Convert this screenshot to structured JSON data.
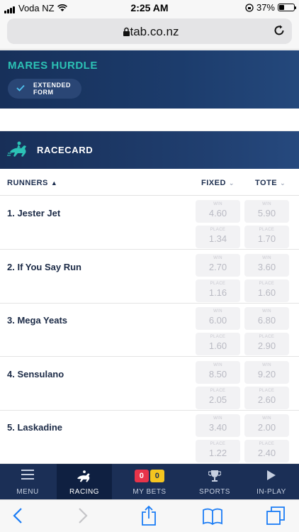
{
  "status": {
    "carrier": "Voda NZ",
    "time": "2:25 AM",
    "battery": "37%",
    "battery_fraction": 0.37
  },
  "browser": {
    "url": "tab.co.nz"
  },
  "race": {
    "title": "MARES HURDLE",
    "extended_form_line1": "EXTENDED",
    "extended_form_line2": "FORM"
  },
  "racecard": {
    "title": "RACECARD"
  },
  "columns": {
    "runners": "RUNNERS",
    "fixed": "FIXED",
    "tote": "TOTE"
  },
  "runners": [
    {
      "name": "1.  Jester Jet",
      "fixed_win": "4.60",
      "tote_win": "5.90",
      "fixed_place": "1.34",
      "tote_place": "1.70"
    },
    {
      "name": "2.  If You Say Run",
      "fixed_win": "2.70",
      "tote_win": "3.60",
      "fixed_place": "1.16",
      "tote_place": "1.60"
    },
    {
      "name": "3.  Mega Yeats",
      "fixed_win": "6.00",
      "tote_win": "6.80",
      "fixed_place": "1.60",
      "tote_place": "2.90"
    },
    {
      "name": "4.  Sensulano",
      "fixed_win": "8.50",
      "tote_win": "9.20",
      "fixed_place": "2.05",
      "tote_place": "2.60"
    },
    {
      "name": "5.  Laskadine",
      "fixed_win": "3.40",
      "tote_win": "2.00",
      "fixed_place": "1.22",
      "tote_place": "2.40"
    }
  ],
  "odds_labels": {
    "win": "WIN",
    "place": "PLACE"
  },
  "nav": {
    "menu": "MENU",
    "racing": "RACING",
    "mybets": "MY BETS",
    "sports": "SPORTS",
    "inplay": "IN-PLAY",
    "badge_red": "0",
    "badge_yellow": "0"
  },
  "colors": {
    "accent_teal": "#2cc2b5",
    "nav_bg": "#1b2f56",
    "safari_blue": "#1a7cf5"
  },
  "icons": [
    "wifi-icon",
    "lock-icon",
    "reload-icon",
    "check-icon",
    "jockey-icon",
    "chevron-up-icon",
    "chevron-down-icon",
    "hamburger-icon",
    "trophy-icon",
    "play-icon",
    "back-icon",
    "forward-icon",
    "share-icon",
    "bookmarks-icon",
    "tabs-icon",
    "orientation-lock-icon"
  ]
}
